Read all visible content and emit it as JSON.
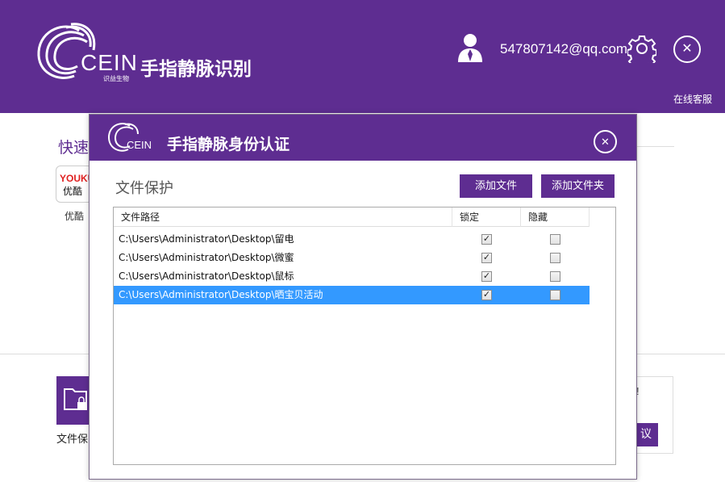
{
  "app": {
    "brand": "CEIN",
    "brand_sub": "识益生物",
    "title": "手指静脉识别",
    "user_email": "547807142@qq.com",
    "online_service": "在线客服"
  },
  "background": {
    "quick_title": "快速",
    "youku_logo": "YOUKU",
    "youku_cn": "优酷",
    "youku_label": "优酷",
    "file_protect_label": "文件保",
    "right_card_text": "!",
    "right_card_btn": "议"
  },
  "dialog": {
    "brand": "CEIN",
    "title": "手指静脉身份认证",
    "section_title": "文件保护",
    "add_file_label": "添加文件",
    "add_folder_label": "添加文件夹",
    "columns": [
      "文件路径",
      "锁定",
      "隐藏"
    ],
    "rows": [
      {
        "path": "C:\\Users\\Administrator\\Desktop\\留电",
        "locked": true,
        "hidden": false,
        "selected": false
      },
      {
        "path": "C:\\Users\\Administrator\\Desktop\\微蜜",
        "locked": true,
        "hidden": false,
        "selected": false
      },
      {
        "path": "C:\\Users\\Administrator\\Desktop\\鼠标",
        "locked": true,
        "hidden": false,
        "selected": false
      },
      {
        "path": "C:\\Users\\Administrator\\Desktop\\晒宝贝活动",
        "locked": true,
        "hidden": false,
        "selected": true
      }
    ]
  },
  "colors": {
    "brand_purple": "#5e2d91",
    "selection_blue": "#3399ff"
  }
}
